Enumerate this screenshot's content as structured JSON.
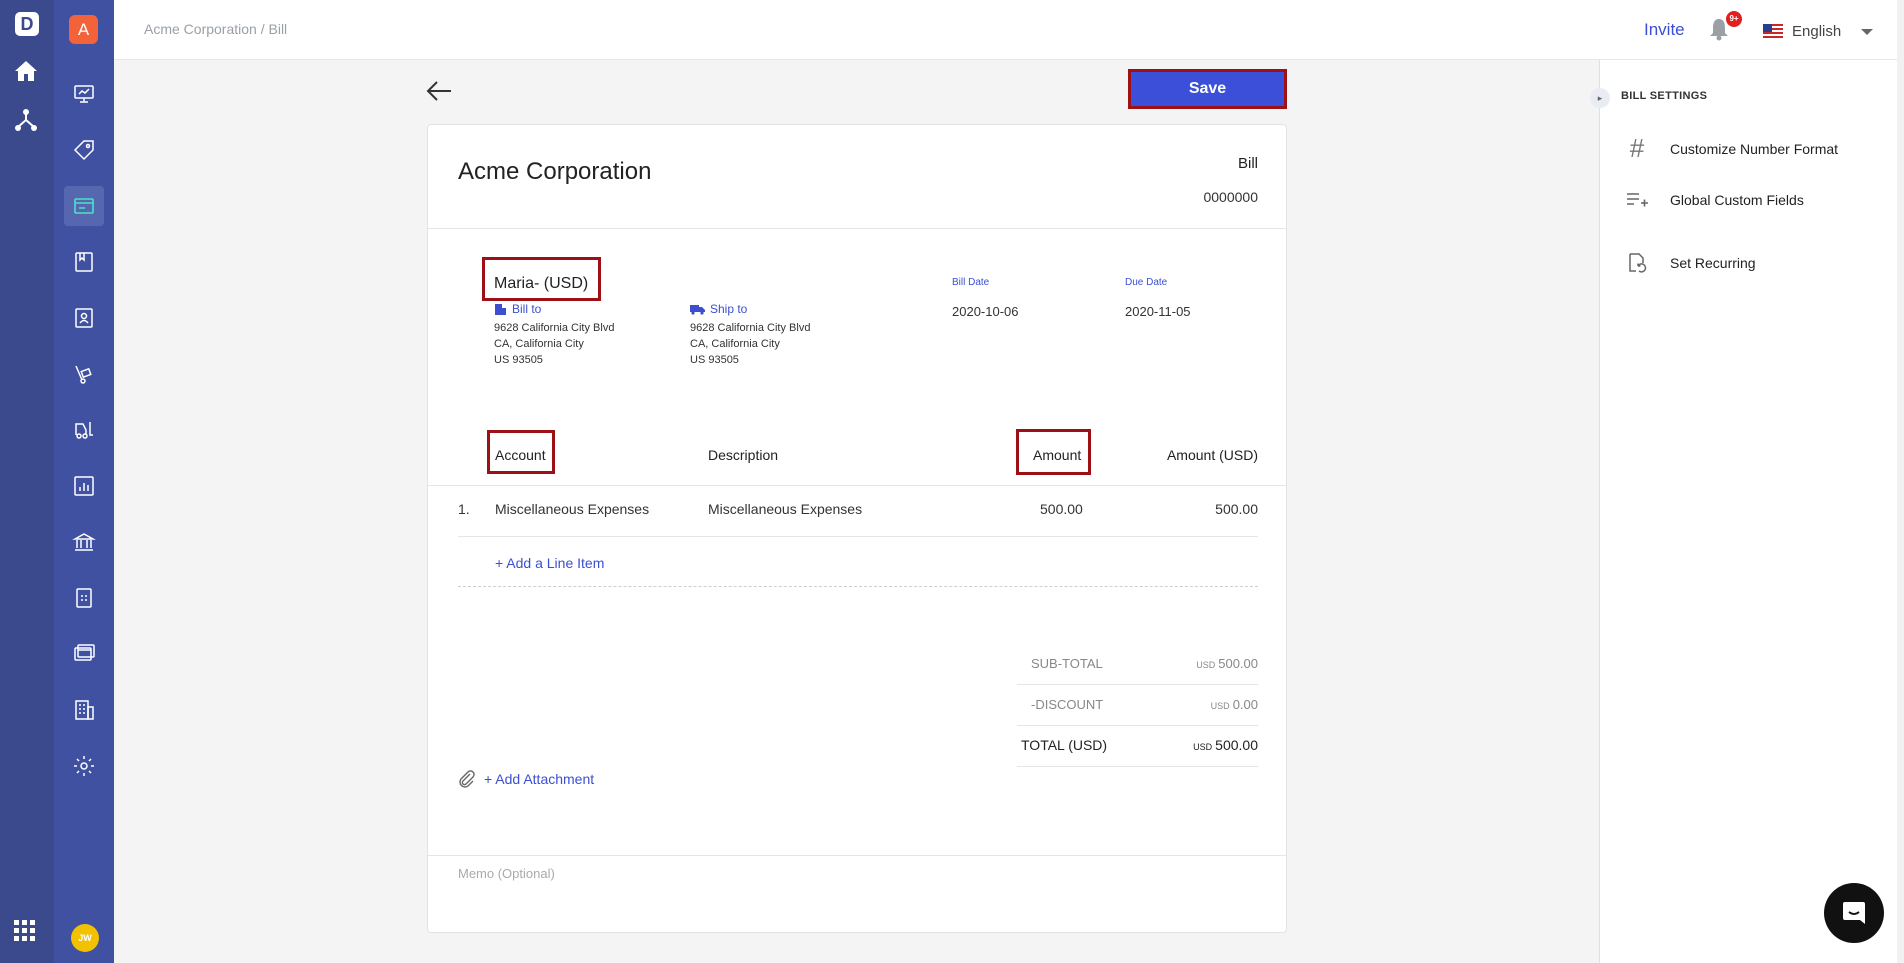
{
  "app": {
    "logo_letter": "D",
    "org_initial": "A",
    "user_initials": "JW"
  },
  "breadcrumb": "Acme Corporation / Bill",
  "topbar": {
    "invite": "Invite",
    "notification_count": "9+",
    "language": "English"
  },
  "toolbar": {
    "save_label": "Save"
  },
  "bill": {
    "company": "Acme Corporation",
    "type": "Bill",
    "number": "0000000",
    "vendor": "Maria- (USD)",
    "bill_to": {
      "label": "Bill to",
      "lines": [
        "9628 California City Blvd",
        "CA, California City",
        "US 93505"
      ]
    },
    "ship_to": {
      "label": "Ship to",
      "lines": [
        "9628 California City Blvd",
        "CA, California City",
        "US 93505"
      ]
    },
    "bill_date": {
      "label": "Bill Date",
      "value": "2020-10-06"
    },
    "due_date": {
      "label": "Due Date",
      "value": "2020-11-05"
    },
    "columns": {
      "account": "Account",
      "description": "Description",
      "amount": "Amount",
      "amount_usd": "Amount (USD)"
    },
    "rows": [
      {
        "num": "1.",
        "account": "Miscellaneous Expenses",
        "description": "Miscellaneous Expenses",
        "amount": "500.00",
        "amount_usd": "500.00"
      }
    ],
    "add_line_item": "+ Add a Line Item",
    "totals": {
      "subtotal_label": "SUB-TOTAL",
      "subtotal_cur": "USD",
      "subtotal": "500.00",
      "discount_label": "-DISCOUNT",
      "discount_cur": "USD",
      "discount": "0.00",
      "total_label": "TOTAL (USD)",
      "total_cur": "USD",
      "total": "500.00"
    },
    "add_attachment": "+ Add Attachment",
    "memo_placeholder": "Memo (Optional)"
  },
  "settings": {
    "title": "BILL SETTINGS",
    "items": [
      {
        "label": "Customize Number Format",
        "icon": "hash-icon"
      },
      {
        "label": "Global Custom Fields",
        "icon": "list-add-icon"
      },
      {
        "label": "Set Recurring",
        "icon": "recurring-icon"
      }
    ]
  },
  "colors": {
    "accent": "#3b4fd8",
    "sidebar": "#3f51a0",
    "highlight": "#9e0f16"
  }
}
